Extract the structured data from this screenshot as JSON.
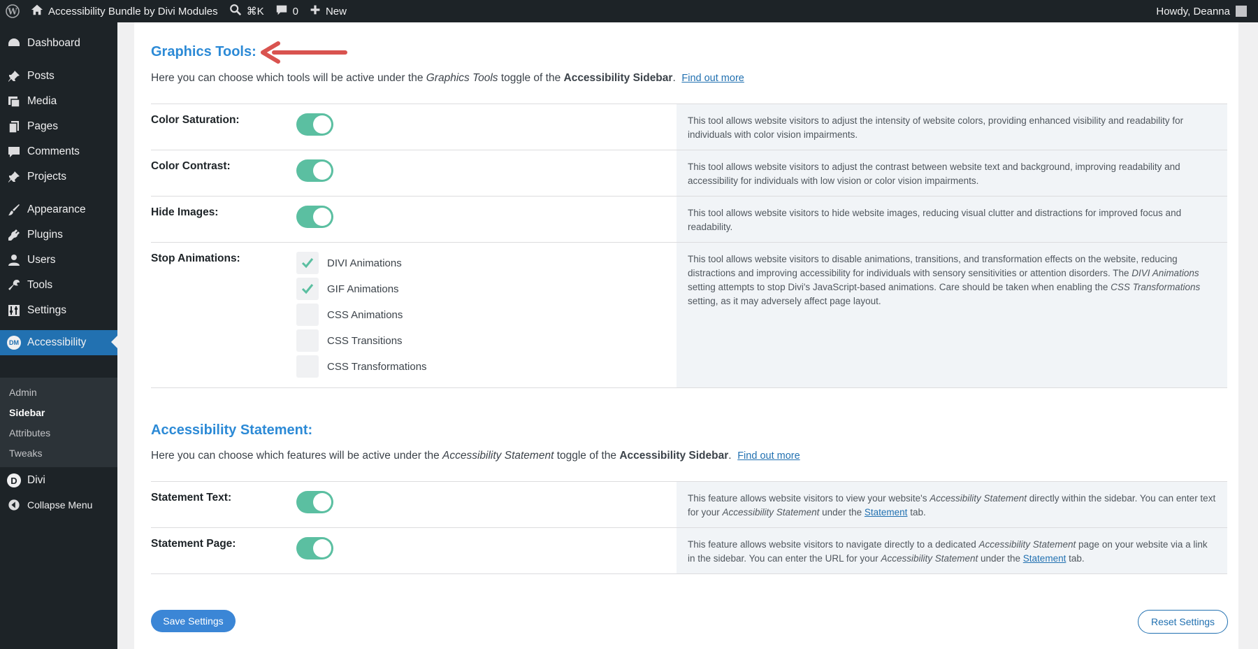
{
  "adminbar": {
    "site_name": "Accessibility Bundle by Divi Modules",
    "search_shortcut": "⌘K",
    "comments_count": "0",
    "new_label": "New",
    "greeting": "Howdy, Deanna"
  },
  "sidebar": {
    "items": [
      {
        "label": "Dashboard",
        "icon": "dashboard-icon"
      },
      {
        "label": "Posts",
        "icon": "pin-icon"
      },
      {
        "label": "Media",
        "icon": "media-icon"
      },
      {
        "label": "Pages",
        "icon": "pages-icon"
      },
      {
        "label": "Comments",
        "icon": "comment-icon"
      },
      {
        "label": "Projects",
        "icon": "pin-icon"
      },
      {
        "label": "Appearance",
        "icon": "brush-icon"
      },
      {
        "label": "Plugins",
        "icon": "plugin-icon"
      },
      {
        "label": "Users",
        "icon": "user-icon"
      },
      {
        "label": "Tools",
        "icon": "wrench-icon"
      },
      {
        "label": "Settings",
        "icon": "settings-icon"
      },
      {
        "label": "Accessibility",
        "icon": "dm-logo-icon",
        "badge": "DM"
      },
      {
        "label": "Divi",
        "icon": "divi-logo-icon",
        "badge": "D"
      },
      {
        "label": "Collapse Menu",
        "icon": "collapse-icon"
      }
    ],
    "submenu": [
      "Admin",
      "Sidebar",
      "Attributes",
      "Tweaks"
    ]
  },
  "graphics": {
    "title": "Graphics Tools:",
    "desc_prefix": "Here you can choose which tools will be active under the ",
    "desc_em": "Graphics Tools",
    "desc_mid": " toggle of the ",
    "desc_bold": "Accessibility Sidebar",
    "desc_suffix": ".",
    "link": "Find out more",
    "rows": [
      {
        "label": "Color Saturation:",
        "desc": "This tool allows website visitors to adjust the intensity of website colors, providing enhanced visibility and readability for individuals with color vision impairments.",
        "enabled": true
      },
      {
        "label": "Color Contrast:",
        "desc": "This tool allows website visitors to adjust the contrast between website text and background, improving readability and accessibility for individuals with low vision or color vision impairments.",
        "enabled": true
      },
      {
        "label": "Hide Images:",
        "desc": "This tool allows website visitors to hide website images, reducing visual clutter and distractions for improved focus and readability.",
        "enabled": true
      }
    ],
    "animations": {
      "label": "Stop Animations:",
      "desc_1": "This tool allows website visitors to disable animations, transitions, and transformation effects on the website, reducing distractions and improving accessibility for individuals with sensory sensitivities or attention disorders. The ",
      "desc_em1": "DIVI Animations",
      "desc_2": " setting attempts to stop Divi's JavaScript-based animations. Care should be taken when enabling the ",
      "desc_em2": "CSS Transformations",
      "desc_3": " setting, as it may adversely affect page layout.",
      "options": [
        {
          "label": "DIVI Animations",
          "checked": true
        },
        {
          "label": "GIF Animations",
          "checked": true
        },
        {
          "label": "CSS Animations",
          "checked": false
        },
        {
          "label": "CSS Transitions",
          "checked": false
        },
        {
          "label": "CSS Transformations",
          "checked": false
        }
      ]
    }
  },
  "statement": {
    "title": "Accessibility Statement:",
    "desc_prefix": "Here you can choose which features will be active under the ",
    "desc_em": "Accessibility Statement",
    "desc_mid": " toggle of the ",
    "desc_bold": "Accessibility Sidebar",
    "desc_suffix": ".",
    "link": "Find out more",
    "text_row": {
      "label": "Statement Text:",
      "d1": "This feature allows website visitors to view your website's ",
      "em1": "Accessibility Statement",
      "d2": " directly within the sidebar. You can enter text for your ",
      "em2": "Accessibility Statement",
      "d3": " under the ",
      "link": "Statement",
      "d4": " tab.",
      "enabled": true
    },
    "page_row": {
      "label": "Statement Page:",
      "d1": "This feature allows website visitors to navigate directly to a dedicated ",
      "em1": "Accessibility Statement",
      "d2": " page on your website via a link in the sidebar. You can enter the URL for your ",
      "em2": "Accessibility Statement",
      "d3": " under the ",
      "link": "Statement",
      "d4": " tab.",
      "enabled": true
    }
  },
  "buttons": {
    "save": "Save Settings",
    "reset": "Reset Settings"
  },
  "colors": {
    "accent": "#2c8ad6",
    "toggle_on": "#5bbfa1",
    "arrow": "#d9534f",
    "sidebar_bg": "#1d2327",
    "current_menu": "#2271b1"
  }
}
